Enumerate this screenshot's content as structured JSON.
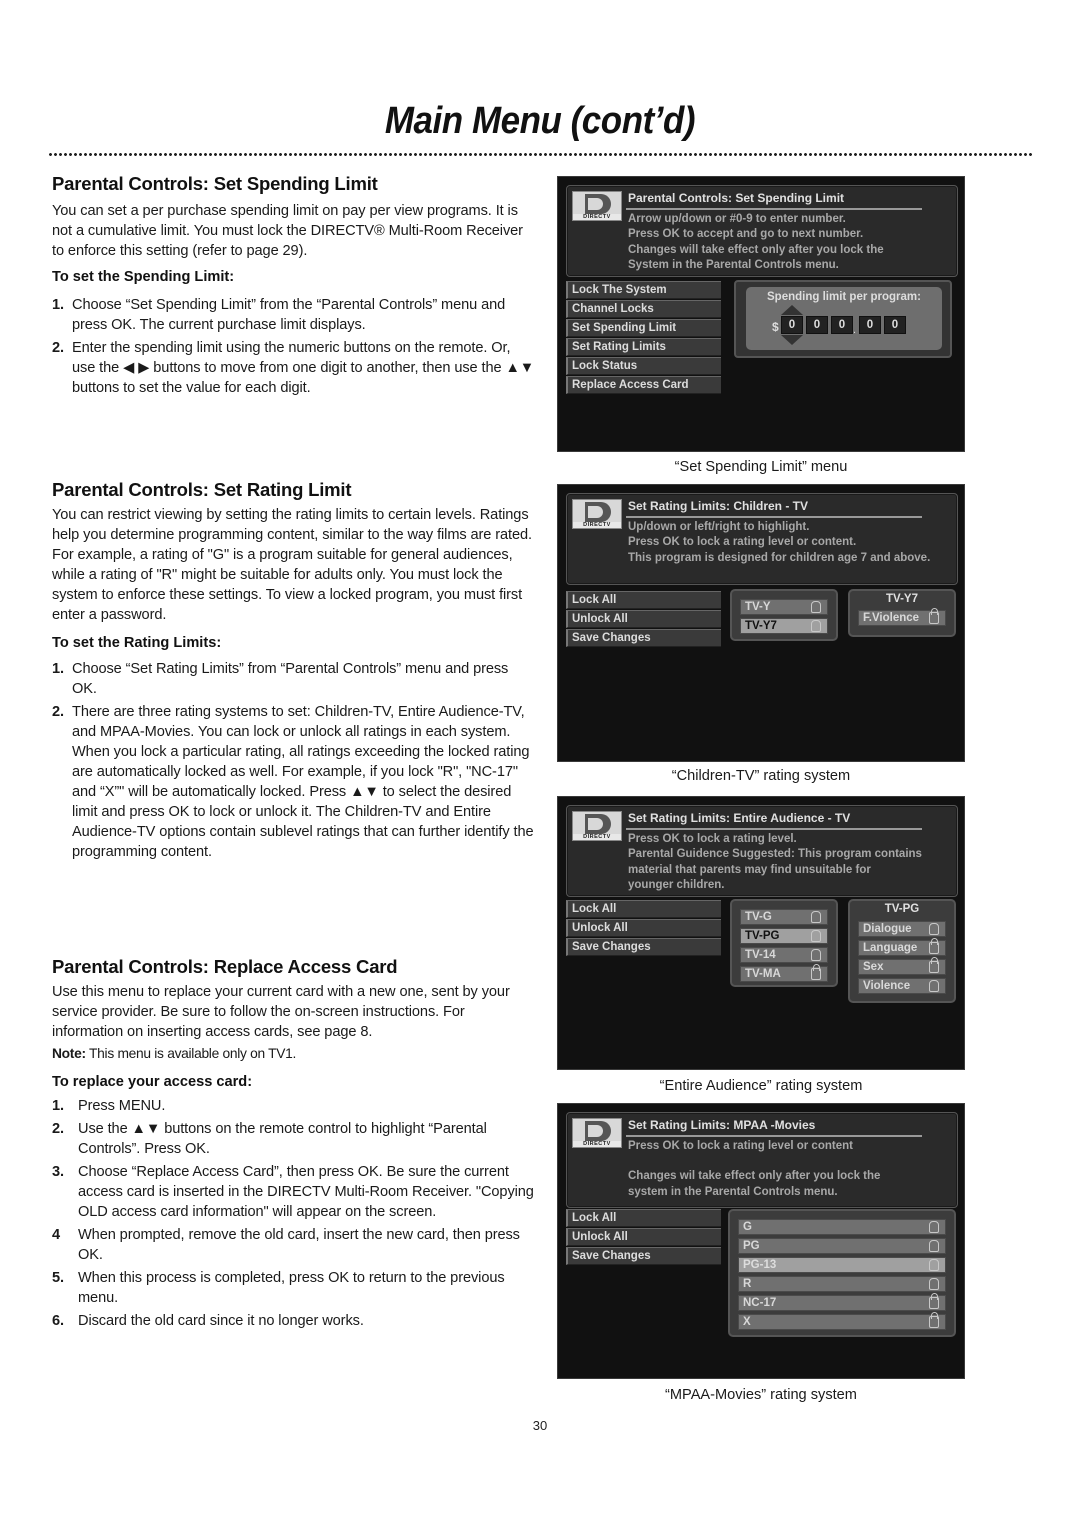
{
  "page": {
    "title": "Main Menu (cont’d)",
    "page_number": "30"
  },
  "sections": {
    "spending": {
      "heading": "Parental Controls: Set Spending Limit",
      "intro": "You can set a per purchase spending limit on pay per view programs. It is not a cumulative limit. You must lock the DIRECTV® Multi-Room Receiver to enforce this setting (refer to page 29).",
      "subheading": "To set the Spending Limit:",
      "steps": [
        {
          "num": "1.",
          "text": "Choose “Set Spending Limit” from the “Parental Controls” menu and press OK. The current purchase limit displays."
        },
        {
          "num": "2.",
          "text": "Enter the spending limit using the numeric buttons on the remote. Or, use the ◀ ▶ buttons to move from one digit to another, then use the ▲▼ buttons to set the value for each digit."
        }
      ]
    },
    "rating": {
      "heading": "Parental Controls: Set Rating Limit",
      "intro": "You can restrict viewing by setting the rating limits to certain levels. Ratings help you determine programming content, similar to the way films are rated. For example, a rating of \"G\" is a program suitable for general audiences, while a rating of \"R\" might be suitable for adults only. You must lock the system to enforce these settings. To view a locked program, you must first enter a password.",
      "subheading": "To set the Rating Limits:",
      "steps": [
        {
          "num": "1.",
          "text": "Choose “Set Rating Limits” from “Parental Controls” menu and press OK."
        },
        {
          "num": "2.",
          "text": "There are three rating systems to set: Children-TV, Entire Audience-TV, and MPAA-Movies. You can lock or unlock all ratings in each system. When you lock a particular rating, all ratings exceeding the locked rating are automatically locked as well. For example, if you lock \"R\", \"NC-17\" and “X”\" will be automatically locked. Press ▲▼ to select the desired limit and press OK to lock or unlock it. The Children-TV and Entire Audience-TV options contain sublevel ratings that can further identify the programming content."
        }
      ]
    },
    "access_card": {
      "heading": "Parental Controls: Replace Access Card",
      "intro": "Use this menu to replace your current card with a new one, sent by your service provider. Be sure to follow the on-screen instructions. For information on inserting access cards, see page 8.",
      "note_label": "Note:",
      "note_text": " This menu is available only on TV1.",
      "subheading": "To replace your access card:",
      "steps": [
        {
          "num": "1.",
          "text": "Press MENU."
        },
        {
          "num": "2.",
          "text": "Use the ▲▼ buttons on the remote control to highlight “Parental Controls”. Press OK."
        },
        {
          "num": "3.",
          "text": "Choose “Replace Access Card”, then press OK. Be sure the current access card is inserted in the DIRECTV Multi-Room Receiver. \"Copying OLD access card information\" will appear on the screen."
        },
        {
          "num": "4",
          "text": "When prompted, remove the old card, insert the new card, then press OK."
        },
        {
          "num": "5.",
          "text": "When this process is completed, press OK to return to the previous menu."
        },
        {
          "num": "6.",
          "text": "Discard the old card since it no longer works."
        }
      ]
    }
  },
  "screens": {
    "logo_text": "DIRECTV",
    "spending": {
      "title": "Parental Controls: Set Spending Limit",
      "lines": [
        "Arrow up/down or #0-9 to enter number.",
        "Press OK to accept and go to next number.",
        "Changes will take effect only after you lock the",
        "System in the Parental Controls menu."
      ],
      "menu": [
        "Lock The System",
        "Channel Locks",
        "Set Spending Limit",
        "Set Rating Limits",
        "Lock Status",
        "Replace Access Card"
      ],
      "panel_label": "Spending limit per program:",
      "currency": "$",
      "digits": [
        "0",
        "0",
        "0",
        "0",
        "0"
      ],
      "decimal": ".",
      "caption": "“Set Spending Limit” menu"
    },
    "children": {
      "title": "Set Rating Limits: Children - TV",
      "lines": [
        "Up/down or left/right to highlight.",
        "Press OK to lock a rating level or content.",
        "This program is designed for children age 7 and above."
      ],
      "menu": [
        "Lock All",
        "Unlock All",
        "Save Changes"
      ],
      "ratings": [
        {
          "label": "TV-Y",
          "locked": false,
          "selected": false
        },
        {
          "label": "TV-Y7",
          "locked": false,
          "selected": true
        }
      ],
      "sub_title": "TV-Y7",
      "sub": [
        {
          "label": "F.Violence",
          "locked": true
        }
      ],
      "caption": "“Children-TV” rating system"
    },
    "entire": {
      "title": "Set Rating Limits: Entire Audience - TV",
      "lines": [
        "Press OK to lock a rating level.",
        "Parental Guidence Suggested: This program contains",
        "material that parents may find unsuitable for",
        "younger children."
      ],
      "menu": [
        "Lock All",
        "Unlock All",
        "Save Changes"
      ],
      "ratings": [
        {
          "label": "TV-G",
          "locked": false,
          "selected": false
        },
        {
          "label": "TV-PG",
          "locked": false,
          "selected": true
        },
        {
          "label": "TV-14",
          "locked": false,
          "selected": false
        },
        {
          "label": "TV-MA",
          "locked": true,
          "selected": false
        }
      ],
      "sub_title": "TV-PG",
      "sub": [
        {
          "label": "Dialogue",
          "locked": false
        },
        {
          "label": "Language",
          "locked": true
        },
        {
          "label": "Sex",
          "locked": true
        },
        {
          "label": "Violence",
          "locked": false
        }
      ],
      "caption": "“Entire Audience” rating system"
    },
    "mpaa": {
      "title": "Set Rating Limits: MPAA -Movies",
      "lines": [
        "Press OK to lock a rating level or content",
        "",
        "Changes wil take effect only after you lock the",
        "system in the Parental Controls menu."
      ],
      "menu": [
        "Lock All",
        "Unlock All",
        "Save Changes"
      ],
      "ratings": [
        {
          "label": "G",
          "locked": false,
          "selected": false
        },
        {
          "label": "PG",
          "locked": false,
          "selected": false
        },
        {
          "label": "PG-13",
          "locked": false,
          "selected": true
        },
        {
          "label": "R",
          "locked": false,
          "selected": false
        },
        {
          "label": "NC-17",
          "locked": true,
          "selected": false
        },
        {
          "label": "X",
          "locked": true,
          "selected": false
        }
      ],
      "caption": "“MPAA-Movies” rating system"
    }
  }
}
